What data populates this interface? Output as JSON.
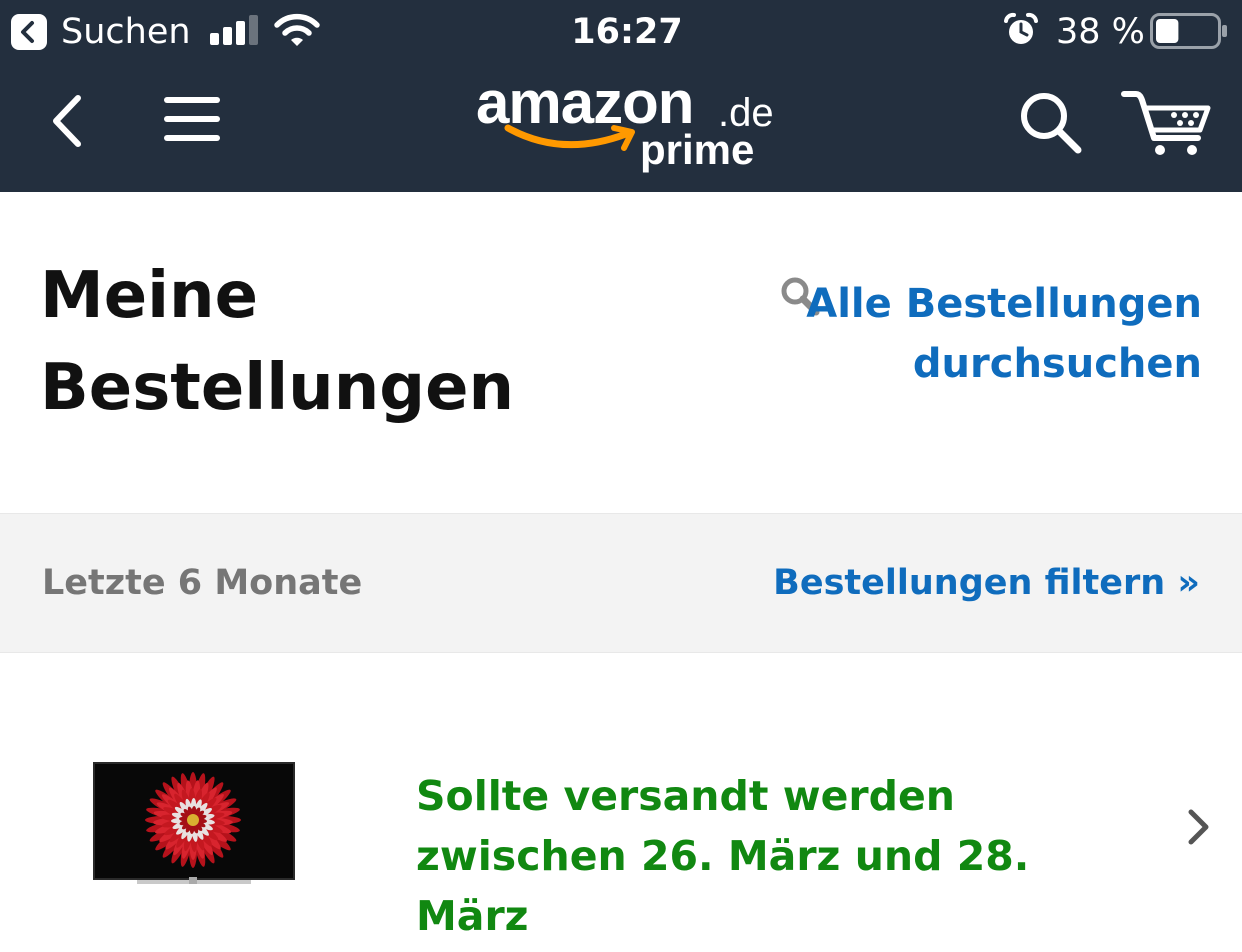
{
  "status_bar": {
    "back_app_label": "Suchen",
    "time": "16:27",
    "battery_percent": "38 %",
    "battery_level": 0.38,
    "signal_bars": 3,
    "icons": [
      "back-to-app-icon",
      "signal-icon",
      "wifi-icon",
      "alarm-icon",
      "battery-icon"
    ]
  },
  "nav": {
    "logo_word": "amazon",
    "logo_tld": ".de",
    "logo_sub": "prime",
    "icons": [
      "back-icon",
      "menu-icon",
      "search-icon",
      "cart-icon"
    ]
  },
  "header": {
    "title": "Meine Bestellungen",
    "search_link": "Alle Bestellungen durchsuchen"
  },
  "filter": {
    "period": "Letzte 6 Monate",
    "filter_link": "Bestellungen filtern »"
  },
  "orders": [
    {
      "status": "Sollte versandt werden zwischen 26. März und 28. März",
      "image": "tv-with-red-flower-wallpaper"
    }
  ],
  "colors": {
    "nav_background": "#232f3e",
    "link_blue": "#0f6cbd",
    "status_green": "#118811",
    "logo_smile_orange": "#ff9900",
    "filter_background": "#f3f3f3"
  }
}
